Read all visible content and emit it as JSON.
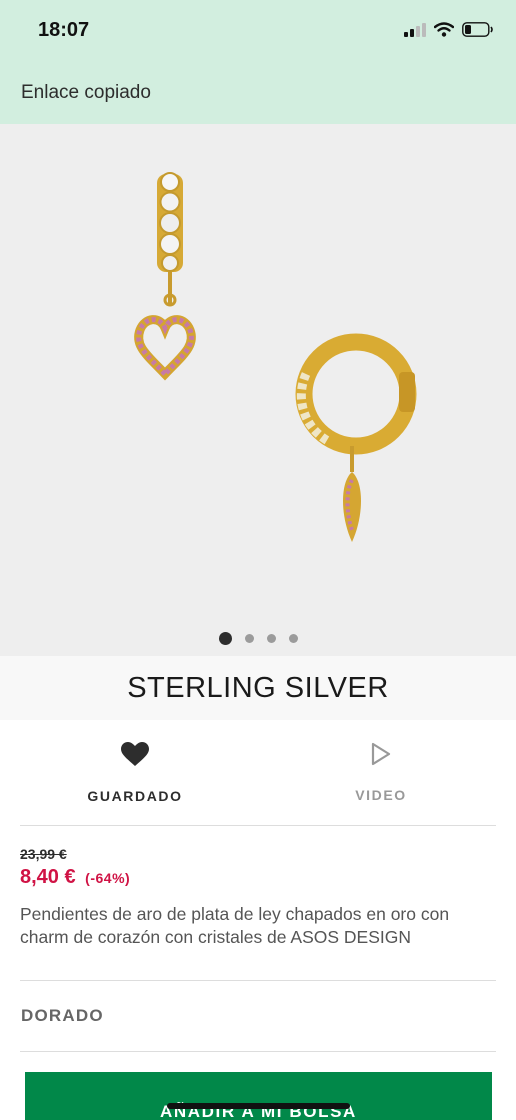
{
  "status_bar": {
    "time": "18:07",
    "icons": [
      "signal-icon",
      "wifi-icon",
      "battery-icon"
    ]
  },
  "toast": {
    "message": "Enlace copiado"
  },
  "gallery": {
    "image_alt": "Pendientes de aro dorados con charm de corazón",
    "page_count": 4,
    "active_page": 1
  },
  "brand": {
    "name": "STERLING SILVER"
  },
  "actions": {
    "saved_label": "GUARDADO",
    "saved_icon": "heart-icon",
    "video_label": "VIDEO",
    "video_icon": "play-icon"
  },
  "product": {
    "old_price": "23,99 €",
    "price": "8,40 €",
    "discount": "(-64%)",
    "description": "Pendientes de aro de plata de ley chapados en oro con charm de corazón con cristales de ASOS DESIGN",
    "colour": "DORADO"
  },
  "cta": {
    "label": "AÑADIR A MI BOLSA"
  },
  "colors": {
    "toast_bg": "#d2eedf",
    "sale_red": "#d01345",
    "cta_green": "#018849",
    "image_bg": "#eeeeee"
  }
}
